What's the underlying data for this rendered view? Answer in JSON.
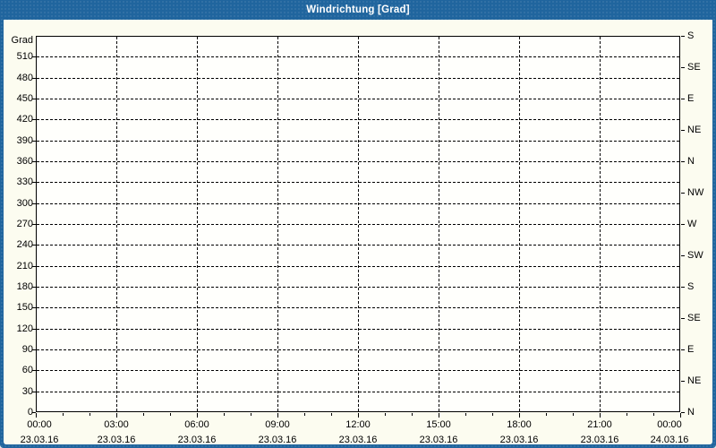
{
  "window": {
    "title": "Windrichtung [Grad]"
  },
  "colors": {
    "chrome_blue": "#20659E",
    "background": "#FCFCF0",
    "plot_background": "#FFFFFC",
    "grid": "#000000",
    "text": "#000000",
    "title_text": "#FFFFFF"
  },
  "chart_data": {
    "type": "line",
    "title": "Windrichtung [Grad]",
    "series": [],
    "note": "empty plot - no data series drawn",
    "grid": {
      "style": "dashed",
      "horizontal_step_deg": 30,
      "vertical_step_hours": 3
    },
    "y_axis_left": {
      "unit_label": "Grad",
      "min": 0,
      "max": 540,
      "step": 30,
      "tick_labels_top_to_bottom": [
        "510",
        "480",
        "450",
        "420",
        "390",
        "360",
        "330",
        "300",
        "270",
        "240",
        "210",
        "180",
        "150",
        "120",
        "90",
        "60",
        "30",
        "0"
      ]
    },
    "y_axis_right": {
      "step_deg": 45,
      "labels_top_to_bottom": [
        "S",
        "SE",
        "E",
        "NE",
        "N",
        "NW",
        "W",
        "SW",
        "S",
        "SE",
        "E",
        "NE",
        "N"
      ]
    },
    "x_axis": {
      "start_hour": 0,
      "end_hour": 24,
      "major_step_hours": 3,
      "minor_step_hours": 1,
      "tick_times": [
        "00:00",
        "03:00",
        "06:00",
        "09:00",
        "12:00",
        "15:00",
        "18:00",
        "21:00",
        "00:00"
      ],
      "tick_dates": [
        "23.03.16",
        "23.03.16",
        "23.03.16",
        "23.03.16",
        "23.03.16",
        "23.03.16",
        "23.03.16",
        "23.03.16",
        "24.03.16"
      ]
    }
  }
}
